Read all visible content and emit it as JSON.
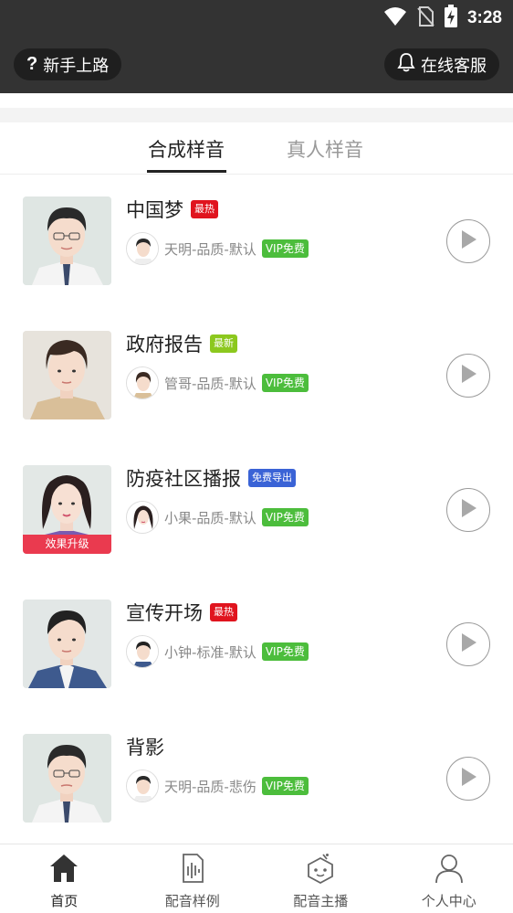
{
  "status_bar": {
    "time": "3:28"
  },
  "header": {
    "left_button": "新手上路",
    "right_button": "在线客服"
  },
  "tabs": [
    {
      "label": "合成样音",
      "active": true
    },
    {
      "label": "真人样音",
      "active": false
    }
  ],
  "items": [
    {
      "title": "中国梦",
      "badge": "最热",
      "badge_color": "#e0141e",
      "voice": "天明-品质-默认",
      "vip": "VIP免费",
      "thumb_tag": ""
    },
    {
      "title": "政府报告",
      "badge": "最新",
      "badge_color": "#8cc81e",
      "voice": "管哥-品质-默认",
      "vip": "VIP免费",
      "thumb_tag": ""
    },
    {
      "title": "防疫社区播报",
      "badge": "免费导出",
      "badge_color": "#3a63d6",
      "voice": "小果-品质-默认",
      "vip": "VIP免费",
      "thumb_tag": "效果升级"
    },
    {
      "title": "宣传开场",
      "badge": "最热",
      "badge_color": "#e0141e",
      "voice": "小钟-标准-默认",
      "vip": "VIP免费",
      "thumb_tag": ""
    },
    {
      "title": "背影",
      "badge": "",
      "badge_color": "",
      "voice": "天明-品质-悲伤",
      "vip": "VIP免费",
      "thumb_tag": ""
    }
  ],
  "bottom_nav": [
    {
      "label": "首页",
      "icon": "home-icon",
      "active": true
    },
    {
      "label": "配音样例",
      "icon": "audio-file-icon",
      "active": false
    },
    {
      "label": "配音主播",
      "icon": "robot-icon",
      "active": false
    },
    {
      "label": "个人中心",
      "icon": "person-icon",
      "active": false
    }
  ],
  "colors": {
    "header_bg": "#333333",
    "vip_green": "#4cbd3c",
    "hot_red": "#e0141e",
    "new_green": "#8cc81e",
    "export_blue": "#3a63d6"
  }
}
